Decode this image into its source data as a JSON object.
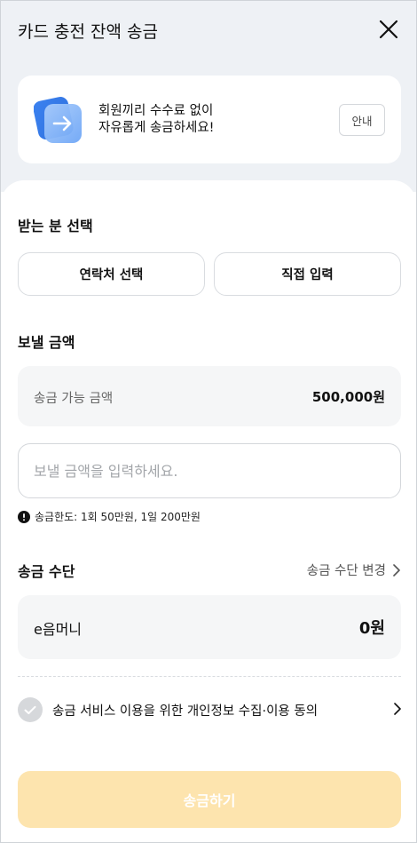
{
  "header": {
    "title": "카드 충전 잔액 송금"
  },
  "banner": {
    "line1": "회원끼리 수수료 없이",
    "line2": "자유롭게 송금하세요!",
    "guide_label": "안내"
  },
  "recipient": {
    "section_title": "받는 분 선택",
    "contact_button": "연락처 선택",
    "direct_button": "직접 입력"
  },
  "amount": {
    "section_title": "보낼 금액",
    "available_label": "송금 가능 금액",
    "available_value": "500,000원",
    "input_placeholder": "보낼 금액을 입력하세요.",
    "input_value": "",
    "limit_text": "송금한도: 1회 50만원, 1일 200만원"
  },
  "method": {
    "section_title": "송금 수단",
    "change_label": "송금 수단 변경",
    "name": "e음머니",
    "balance": "0원"
  },
  "consent": {
    "text": "송금 서비스 이용을 위한 개인정보 수집·이용 동의"
  },
  "submit": {
    "label": "송금하기"
  },
  "colors": {
    "top_background": "#eef1f5",
    "banner_icon": "#4a8df0",
    "submit_disabled": "#fde4ae",
    "check_disabled": "#d6d8db"
  }
}
